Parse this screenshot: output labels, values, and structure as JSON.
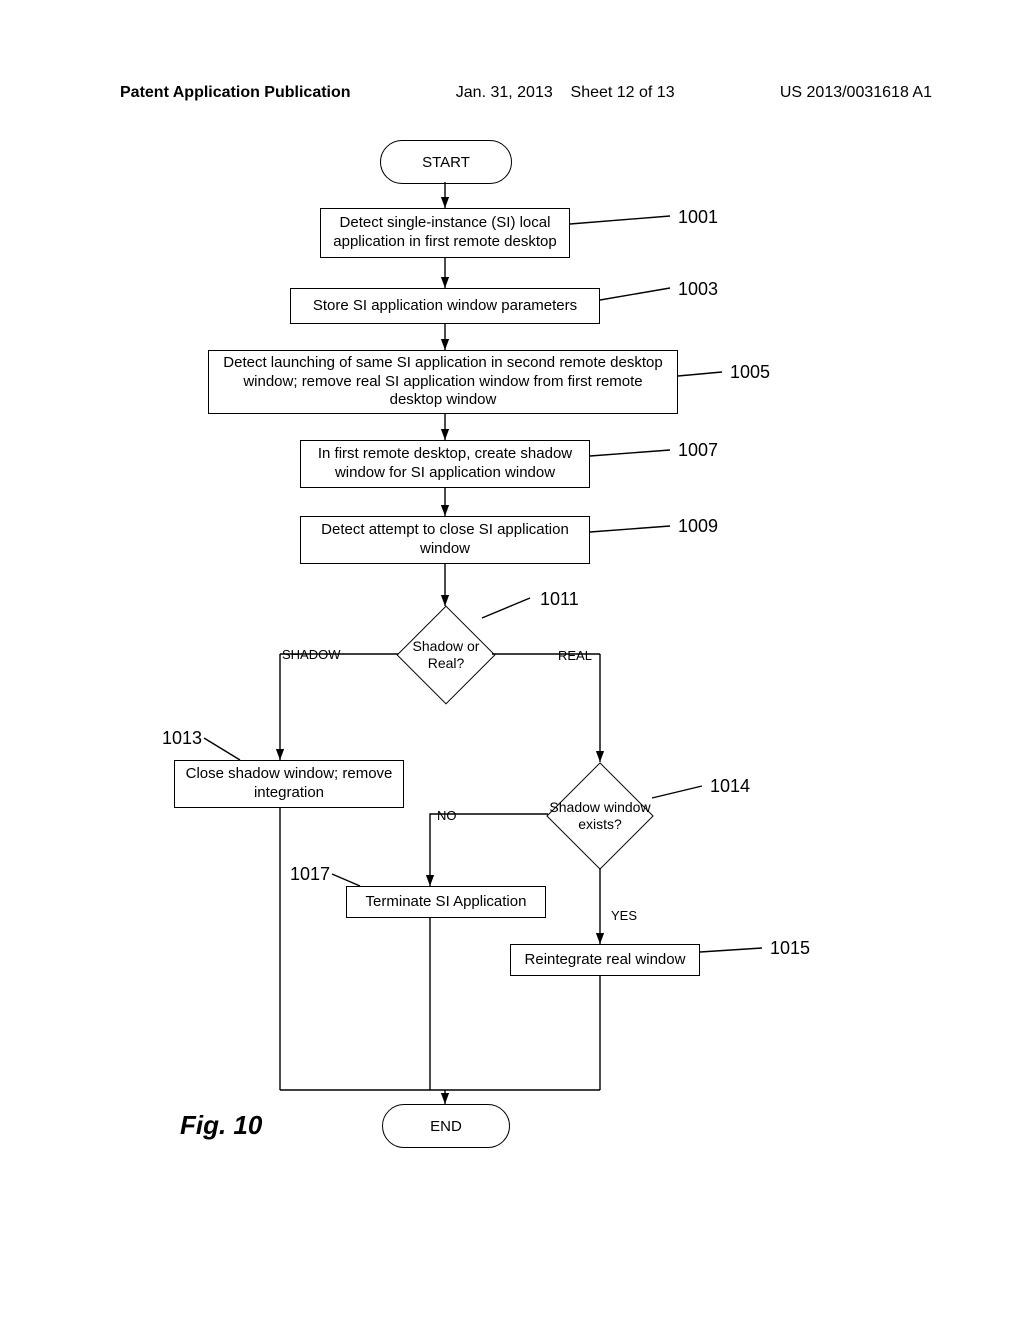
{
  "header": {
    "pub": "Patent Application Publication",
    "date": "Jan. 31, 2013",
    "sheet": "Sheet 12 of 13",
    "code": "US 2013/0031618 A1"
  },
  "terminator": {
    "start": "START",
    "end": "END"
  },
  "process": {
    "p1001": "Detect single-instance (SI) local application in first remote desktop",
    "p1003": "Store SI application window parameters",
    "p1005": "Detect launching of same SI application in second remote desktop window; remove real SI application window from first remote desktop window",
    "p1007": "In first remote desktop, create shadow window for SI application window",
    "p1009": "Detect attempt to close SI application window",
    "p1013": "Close shadow window; remove integration",
    "p1017": "Terminate SI Application",
    "p1015": "Reintegrate real window"
  },
  "decision": {
    "d1011": "Shadow or Real?",
    "d1014": "Shadow window exists?"
  },
  "edge": {
    "shadow": "SHADOW",
    "real": "REAL",
    "no": "NO",
    "yes": "YES"
  },
  "ref": {
    "r1001": "1001",
    "r1003": "1003",
    "r1005": "1005",
    "r1007": "1007",
    "r1009": "1009",
    "r1011": "1011",
    "r1013": "1013",
    "r1014": "1014",
    "r1015": "1015",
    "r1017": "1017"
  },
  "figure": "Fig. 10"
}
